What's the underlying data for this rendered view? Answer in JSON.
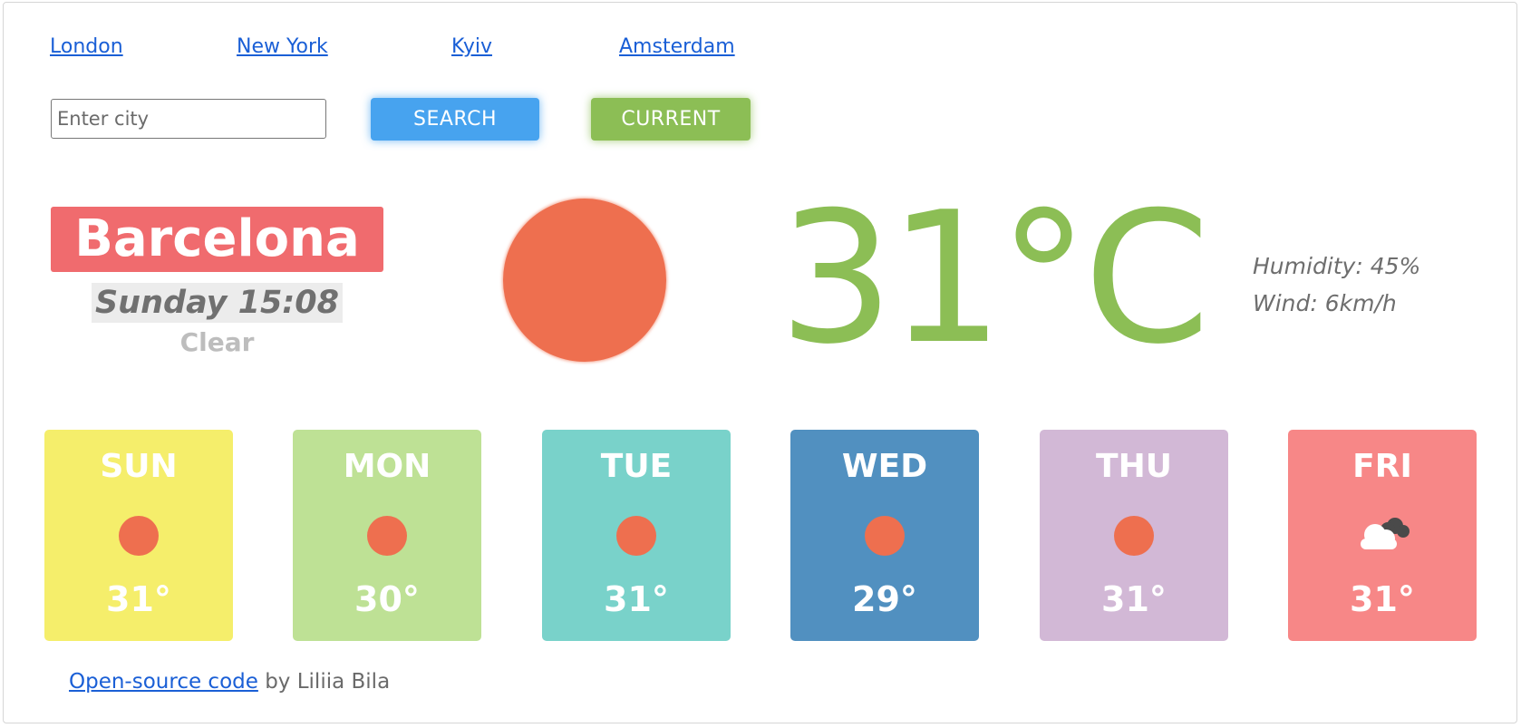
{
  "quick_links": [
    "London",
    "New York",
    "Kyiv",
    "Amsterdam"
  ],
  "search": {
    "placeholder": "Enter city",
    "value": "",
    "search_label": "SEARCH",
    "current_label": "CURRENT"
  },
  "current": {
    "city": "Barcelona",
    "datetime": "Sunday 15:08",
    "description": "Clear",
    "temperature": "31°C",
    "humidity": "Humidity: 45%",
    "wind": "Wind: 6km/h",
    "icon": "sun-icon"
  },
  "forecast": [
    {
      "day": "SUN",
      "temp": "31°",
      "icon": "sun-icon",
      "color": "#f5ee6b"
    },
    {
      "day": "MON",
      "temp": "30°",
      "icon": "sun-icon",
      "color": "#bee195"
    },
    {
      "day": "TUE",
      "temp": "31°",
      "icon": "sun-icon",
      "color": "#79d2ca"
    },
    {
      "day": "WED",
      "temp": "29°",
      "icon": "sun-icon",
      "color": "#5190c0"
    },
    {
      "day": "THU",
      "temp": "31°",
      "icon": "sun-icon",
      "color": "#d2b8d6"
    },
    {
      "day": "FRI",
      "temp": "31°",
      "icon": "cloud-icon",
      "color": "#f78787"
    }
  ],
  "footer": {
    "link_text": "Open-source code",
    "author_text": " by Liliia Bila"
  },
  "colors": {
    "accent_green": "#8cbe55",
    "accent_blue": "#47a3ef",
    "city_badge": "#f06b6e",
    "sun": "#ee6f4f"
  }
}
